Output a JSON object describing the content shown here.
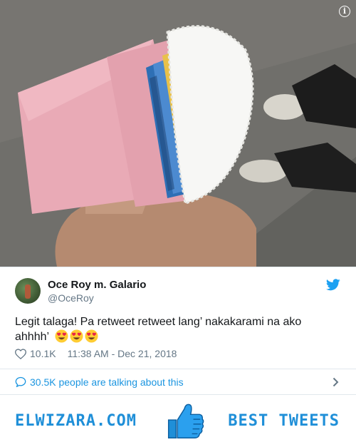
{
  "photo": {
    "description_icon": "info-icon",
    "info_label": "i"
  },
  "tweet": {
    "author_name": "Oce Roy m. Galario",
    "author_handle": "@OceRoy",
    "text": "Legit talaga!  Pa retweet retweet lang’ nakakarami na ako ahhhh’",
    "emoji_count": 3,
    "emoji_name": "smiling-face-with-heart-eyes",
    "likes": "10.1K",
    "timestamp": "11:38 AM - Dec 21, 2018",
    "twitter_icon": "twitter-bird-icon",
    "like_icon": "heart-icon"
  },
  "conversation": {
    "label": "30.5K people are talking about this",
    "icon": "comment-bubble-icon"
  },
  "footer": {
    "site_name": "ELWIZARA.COM",
    "tagline": "BEST TWEETS",
    "logo_icon": "thumbs-up-icon"
  },
  "colors": {
    "twitter_blue": "#1da1f2",
    "link_blue": "#1b95e0",
    "footer_blue": "#1f8fd8",
    "text": "#14171a",
    "muted": "#657786",
    "envelope_pink": "#e9aab6"
  }
}
